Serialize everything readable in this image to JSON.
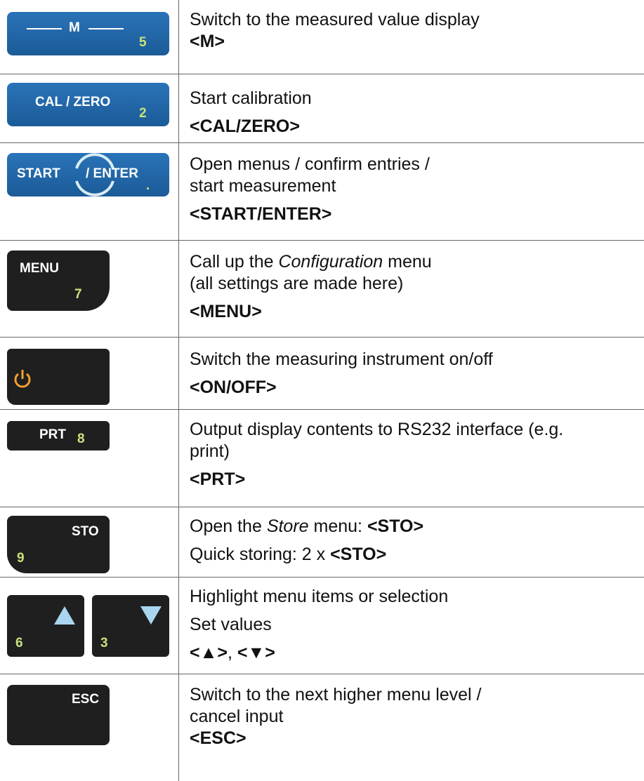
{
  "rows": [
    {
      "key": {
        "label": "M",
        "num": "5"
      },
      "lines": [
        {
          "text": "Switch to the measured value display"
        },
        {
          "bold": "<M>"
        }
      ]
    },
    {
      "key": {
        "label": "CAL / ZERO",
        "num": "2"
      },
      "lines": [
        {
          "text": "Start calibration"
        },
        {
          "bold": "<CAL/ZERO>"
        }
      ]
    },
    {
      "key": {
        "label_a": "START",
        "label_b": "/ ENTER",
        "num": "."
      },
      "lines": [
        {
          "text": "Open menus / confirm entries /"
        },
        {
          "text": "start measurement"
        },
        {
          "bold": "<START/ENTER>"
        }
      ]
    },
    {
      "key": {
        "label": "MENU",
        "num": "7"
      },
      "lines": [
        {
          "pre": "Call up the ",
          "italic": "Configuration",
          "post": " menu"
        },
        {
          "text": "(all settings are made here)"
        },
        {
          "bold": "<MENU>"
        }
      ]
    },
    {
      "key": {
        "icon": "power-icon"
      },
      "lines": [
        {
          "text": "Switch the measuring instrument on/off"
        },
        {
          "bold": "<ON/OFF>"
        }
      ]
    },
    {
      "key": {
        "label": "PRT",
        "num": "8"
      },
      "lines": [
        {
          "text": "Output display contents to RS232 interface (e.g."
        },
        {
          "text": "print)"
        },
        {
          "bold": "<PRT>"
        }
      ]
    },
    {
      "key": {
        "label": "STO",
        "num": "9"
      },
      "lines": [
        {
          "pre": "Open the ",
          "italic": "Store",
          "post": " menu: ",
          "bold": "<STO>"
        },
        {
          "pre": "Quick storing: 2 x ",
          "bold": "<STO>"
        }
      ]
    },
    {
      "key": {
        "up_num": "6",
        "down_num": "3",
        "up_icon": "up-triangle-icon",
        "down_icon": "down-triangle-icon"
      },
      "lines": [
        {
          "text": "Highlight menu items or selection"
        },
        {
          "text": "Set values"
        },
        {
          "bold_a": "<▲>",
          "sep": ", ",
          "bold_b": "<▼>"
        }
      ]
    },
    {
      "key": {
        "label": "ESC"
      },
      "lines": [
        {
          "text": "Switch to the next higher menu level /"
        },
        {
          "text": "cancel input"
        },
        {
          "bold": "<ESC>"
        }
      ]
    }
  ],
  "colors": {
    "blue_key": "#2a73b8",
    "dark_key": "#1f1f1f",
    "key_number": "#c9e27c",
    "power_icon": "#f0a030",
    "arrow_icon": "#a9d6ee"
  }
}
